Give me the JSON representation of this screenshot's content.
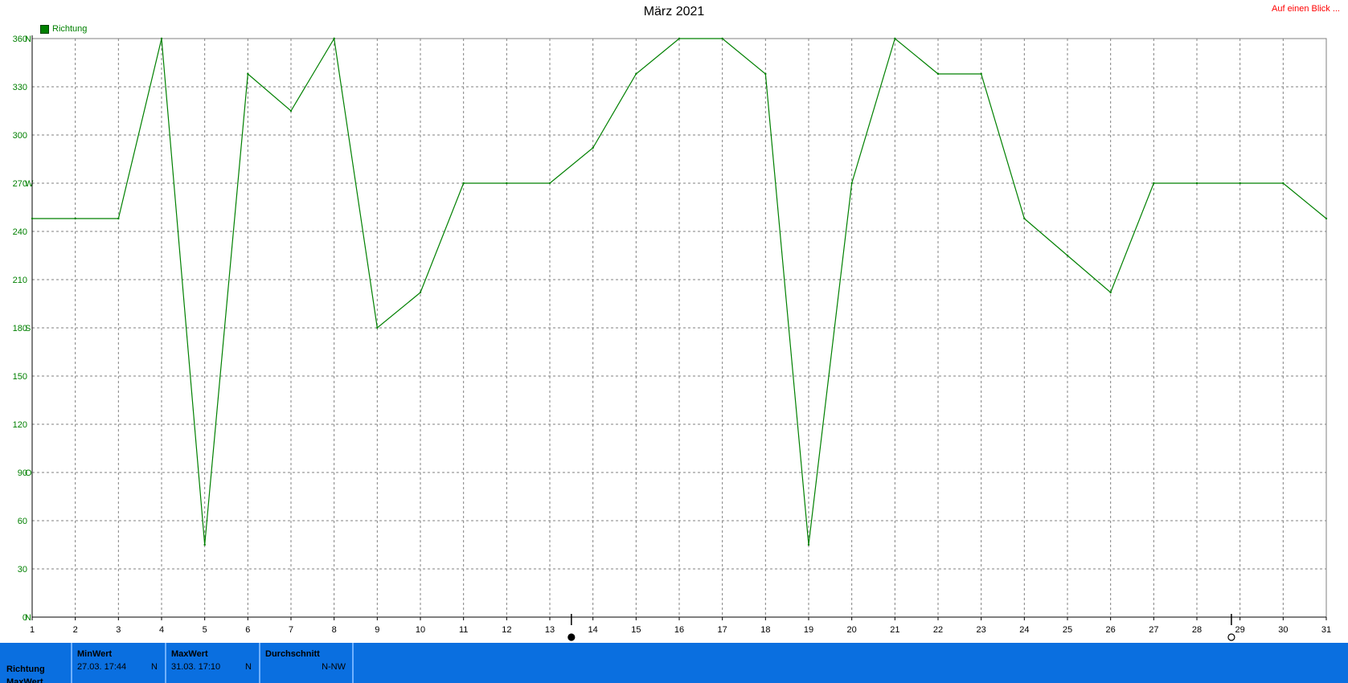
{
  "header": {
    "title": "März 2021",
    "quick_link": "Auf einen Blick ..."
  },
  "legend": {
    "label": "Richtung",
    "color": "#008000"
  },
  "chart_data": {
    "type": "line",
    "title": "März 2021",
    "xlabel": "",
    "ylabel": "",
    "x": [
      1,
      2,
      3,
      4,
      5,
      6,
      7,
      8,
      9,
      10,
      11,
      12,
      13,
      14,
      15,
      16,
      17,
      18,
      19,
      20,
      21,
      22,
      23,
      24,
      25,
      26,
      27,
      28,
      29,
      30,
      31
    ],
    "series": [
      {
        "name": "Richtung",
        "color": "#008000",
        "values": [
          248,
          248,
          248,
          360,
          45,
          338,
          315,
          360,
          180,
          202,
          270,
          270,
          270,
          292,
          338,
          360,
          360,
          338,
          45,
          270,
          360,
          338,
          338,
          248,
          225,
          202,
          270,
          270,
          270,
          270,
          248
        ]
      }
    ],
    "xlim": [
      1,
      31
    ],
    "ylim": [
      0,
      360
    ],
    "yticks": [
      0,
      30,
      60,
      90,
      120,
      150,
      180,
      210,
      240,
      270,
      300,
      330,
      360
    ],
    "ytick_labels": [
      "0",
      "30",
      "60",
      "90",
      "120",
      "150",
      "180",
      "210",
      "240",
      "270",
      "300",
      "330",
      "360"
    ],
    "compass_ticks": [
      {
        "value": 0,
        "label": "N"
      },
      {
        "value": 90,
        "label": "O"
      },
      {
        "value": 180,
        "label": "S"
      },
      {
        "value": 270,
        "label": "W"
      },
      {
        "value": 360,
        "label": "N"
      }
    ],
    "xtick_labels": [
      "1",
      "2",
      "3",
      "4",
      "5",
      "6",
      "7",
      "8",
      "9",
      "10",
      "11",
      "12",
      "13",
      "14",
      "15",
      "16",
      "17",
      "18",
      "19",
      "20",
      "21",
      "22",
      "23",
      "24",
      "25",
      "26",
      "27",
      "28",
      "29",
      "30",
      "31"
    ],
    "grid": true,
    "legend_position": "top-left",
    "markers": [
      {
        "x": 13.5,
        "symbol": "new-moon"
      },
      {
        "x": 28.8,
        "symbol": "full-moon"
      }
    ]
  },
  "stats_panel": {
    "row_label_1": "Richtung",
    "row_label_2": "MaxWert",
    "min": {
      "header": "MinWert",
      "value": "27.03.  17:44",
      "dir": "N"
    },
    "max": {
      "header": "MaxWert",
      "value": "31.03.  17:10",
      "dir": "N"
    },
    "avg": {
      "header": "Durchschnitt",
      "value": "",
      "dir": "N-NW"
    }
  }
}
